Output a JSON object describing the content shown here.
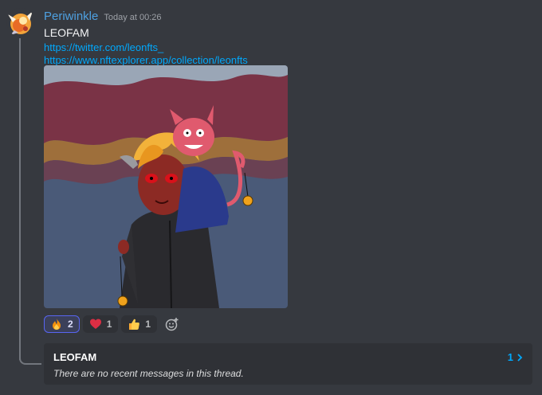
{
  "message": {
    "username": "Periwinkle",
    "timestamp": "Today at 00:26",
    "text": "LEOFAM",
    "links": [
      "https://twitter.com/leonfts_",
      "https://www.nftexplorer.app/collection/leonfts"
    ]
  },
  "attachment": {
    "kind": "image",
    "subject": "cartoon art: blond boy with horn and red eyes in black jacket, small red devil on shoulder, gold coin pendants"
  },
  "reactions": [
    {
      "emoji": "fire",
      "count": "2",
      "active": true
    },
    {
      "emoji": "red-heart",
      "count": "1",
      "active": false
    },
    {
      "emoji": "thumbs-up",
      "count": "1",
      "active": false
    }
  ],
  "thread": {
    "title": "LEOFAM",
    "subtitle": "There are no recent messages in this thread.",
    "count": "1"
  },
  "colors": {
    "background": "#36393f",
    "username": "#4ea0e0",
    "link": "#00a8fc",
    "thread_box": "#2f3136",
    "active_reaction_border": "#5865f2"
  }
}
